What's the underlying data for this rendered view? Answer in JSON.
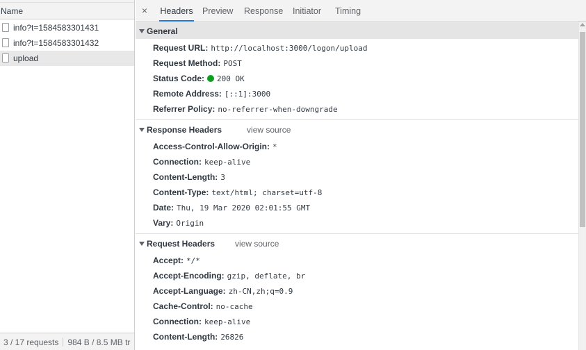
{
  "left_pane": {
    "column_header": "Name",
    "requests": [
      {
        "name": "info?t=1584583301431",
        "selected": false
      },
      {
        "name": "info?t=1584583301432",
        "selected": false
      },
      {
        "name": "upload",
        "selected": true
      }
    ],
    "status": {
      "requests": "3 / 17 requests",
      "transferred": "984 B / 8.5 MB tr"
    }
  },
  "detail": {
    "close_glyph": "×",
    "tabs": [
      {
        "label": "Headers",
        "active": true
      },
      {
        "label": "Preview",
        "active": false
      },
      {
        "label": "Response",
        "active": false
      },
      {
        "label": "Initiator",
        "active": false
      },
      {
        "label": "Timing",
        "active": false
      }
    ],
    "general": {
      "title": "General",
      "rows": [
        {
          "key": "Request URL:",
          "value": "http://localhost:3000/logon/upload"
        },
        {
          "key": "Request Method:",
          "value": "POST"
        },
        {
          "key": "Status Code:",
          "value": "200 OK"
        },
        {
          "key": "Remote Address:",
          "value": "[::1]:3000"
        },
        {
          "key": "Referrer Policy:",
          "value": "no-referrer-when-downgrade"
        }
      ]
    },
    "response_headers": {
      "title": "Response Headers",
      "view_source": "view source",
      "rows": [
        {
          "key": "Access-Control-Allow-Origin:",
          "value": "*"
        },
        {
          "key": "Connection:",
          "value": "keep-alive"
        },
        {
          "key": "Content-Length:",
          "value": "3"
        },
        {
          "key": "Content-Type:",
          "value": "text/html; charset=utf-8"
        },
        {
          "key": "Date:",
          "value": "Thu, 19 Mar 2020 02:01:55 GMT"
        },
        {
          "key": "Vary:",
          "value": "Origin"
        }
      ]
    },
    "request_headers": {
      "title": "Request Headers",
      "view_source": "view source",
      "rows": [
        {
          "key": "Accept:",
          "value": "*/*"
        },
        {
          "key": "Accept-Encoding:",
          "value": "gzip, deflate, br"
        },
        {
          "key": "Accept-Language:",
          "value": "zh-CN,zh;q=0.9"
        },
        {
          "key": "Cache-Control:",
          "value": "no-cache"
        },
        {
          "key": "Connection:",
          "value": "keep-alive"
        },
        {
          "key": "Content-Length:",
          "value": "26826"
        }
      ]
    }
  },
  "colors": {
    "active_tab_underline": "#1a73e8",
    "status_ok": "#0a9f1f",
    "section_header_bg": "#e5e5e5"
  },
  "icons": [
    "close-icon",
    "file-icon",
    "disclosure-triangle-icon",
    "status-ok-dot-icon"
  ]
}
